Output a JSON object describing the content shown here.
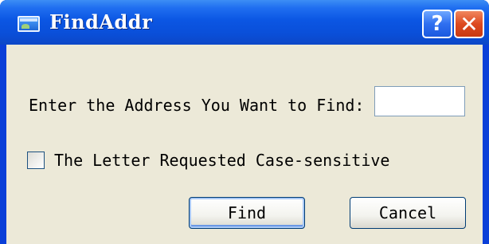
{
  "window": {
    "title": "FindAddr",
    "help_glyph": "?",
    "close_glyph": "✕",
    "app_icon": "window-app-icon"
  },
  "form": {
    "prompt_label": "Enter the Address You Want to Find:",
    "address_value": "",
    "checkbox_label": "The Letter Requested Case-sensitive",
    "checkbox_checked": false,
    "find_label": "Find",
    "cancel_label": "Cancel"
  },
  "colors": {
    "titlebar": "#0a4fd9",
    "client_background": "#ece9d8",
    "close_button": "#dd4a20",
    "help_button": "#2f6ff0"
  }
}
